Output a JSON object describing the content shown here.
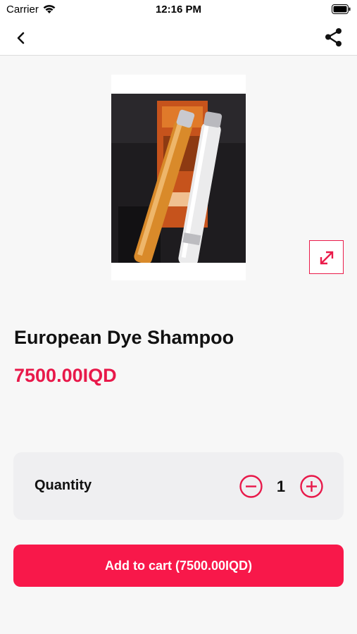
{
  "status_bar": {
    "carrier": "Carrier",
    "time": "12:16 PM"
  },
  "nav": {
    "back_icon": "chevron-left-icon",
    "share_icon": "share-icon"
  },
  "product": {
    "title": "European Dye Shampoo",
    "price": "7500.00IQD",
    "image_alt": "Two shampoo bottles with box"
  },
  "quantity": {
    "label": "Quantity",
    "value": "1"
  },
  "cart": {
    "add_label": "Add to cart (7500.00IQD)"
  },
  "colors": {
    "accent": "#e8194a",
    "button": "#f8184a"
  }
}
